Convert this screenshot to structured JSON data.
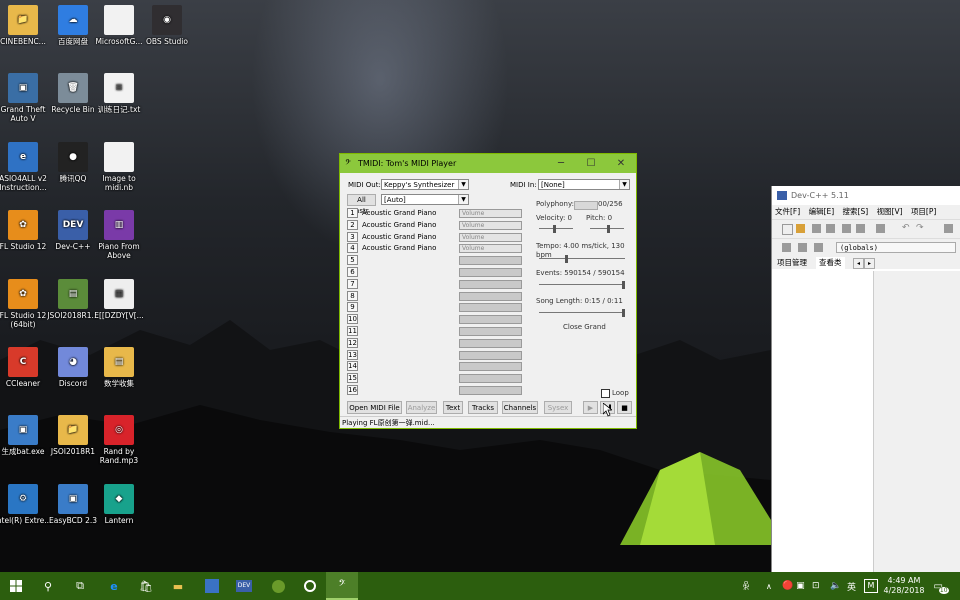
{
  "desktop": {
    "icons": [
      {
        "label": "CINEBENC...",
        "glyph": "📁",
        "color": "#e8b84a"
      },
      {
        "label": "百度网盘",
        "glyph": "☁",
        "color": "#2f7de1"
      },
      {
        "label": "MicrosoftG...",
        "glyph": "",
        "color": "#f2f2f2"
      },
      {
        "label": "OBS Studio",
        "glyph": "◉",
        "color": "#302e31"
      },
      {
        "label": "Grand Theft Auto V",
        "glyph": "▣",
        "color": "#3a6ea5"
      },
      {
        "label": "Recycle Bin",
        "glyph": "🗑",
        "color": "#7c8c99"
      },
      {
        "label": "训练日记.txt",
        "glyph": "≡",
        "color": "#f2f2f2"
      },
      {
        "label": "ASIO4ALL v2 Instruction...",
        "glyph": "e",
        "color": "#2f72c4"
      },
      {
        "label": "腾讯QQ",
        "glyph": "●",
        "color": "#222"
      },
      {
        "label": "Image to midi.nb",
        "glyph": "",
        "color": "#f2f2f2"
      },
      {
        "label": "FL Studio 12",
        "glyph": "✿",
        "color": "#e78d1b"
      },
      {
        "label": "Dev-C++",
        "glyph": "DEV",
        "color": "#3a5fa8"
      },
      {
        "label": "Piano From Above",
        "glyph": "▥",
        "color": "#7a3aa8"
      },
      {
        "label": "FL Studio 12 (64bit)",
        "glyph": "✿",
        "color": "#e78d1b"
      },
      {
        "label": "JSOI2018R1...",
        "glyph": "▤",
        "color": "#5b8c3a"
      },
      {
        "label": "E[[DZDY[V[...",
        "glyph": "▦",
        "color": "#eeeeee"
      },
      {
        "label": "CCleaner",
        "glyph": "C",
        "color": "#d83a2a"
      },
      {
        "label": "Discord",
        "glyph": "◕",
        "color": "#7289da"
      },
      {
        "label": "数学收集",
        "glyph": "▤",
        "color": "#e8b84a"
      },
      {
        "label": "生成bat.exe",
        "glyph": "▣",
        "color": "#3a7cc8"
      },
      {
        "label": "JSOI2018R1",
        "glyph": "📁",
        "color": "#e8b84a"
      },
      {
        "label": "Rand by Rand.mp3",
        "glyph": "◎",
        "color": "#d8232a"
      },
      {
        "label": "Intel(R) Extre...",
        "glyph": "⚙",
        "color": "#2a76c4"
      },
      {
        "label": "EasyBCD 2.3",
        "glyph": "▣",
        "color": "#3a7cc8"
      },
      {
        "label": "Lantern",
        "glyph": "◆",
        "color": "#18a28c"
      }
    ]
  },
  "tmidi": {
    "title": "TMIDI: Tom's MIDI Player",
    "minimize": "─",
    "maximize": "☐",
    "close": "✕",
    "midi_out_label": "MIDI Out:",
    "midi_out_value": "Keppy's Synthesizer",
    "midi_in_label": "MIDI In:",
    "midi_in_value": "[None]",
    "all_instr_label": "All Instr.",
    "instr_value": "[Auto]",
    "tracks": [
      {
        "num": "1",
        "name": "Acoustic Grand Piano",
        "vol": "Volume"
      },
      {
        "num": "2",
        "name": "Acoustic Grand Piano",
        "vol": "Volume"
      },
      {
        "num": "3",
        "name": "Acoustic Grand Piano",
        "vol": "Volume"
      },
      {
        "num": "4",
        "name": "Acoustic Grand Piano",
        "vol": "Volume"
      },
      {
        "num": "5",
        "name": "",
        "vol": ""
      },
      {
        "num": "6",
        "name": "",
        "vol": ""
      },
      {
        "num": "7",
        "name": "",
        "vol": ""
      },
      {
        "num": "8",
        "name": "",
        "vol": ""
      },
      {
        "num": "9",
        "name": "",
        "vol": ""
      },
      {
        "num": "10",
        "name": "",
        "vol": ""
      },
      {
        "num": "11",
        "name": "",
        "vol": ""
      },
      {
        "num": "12",
        "name": "",
        "vol": ""
      },
      {
        "num": "13",
        "name": "",
        "vol": ""
      },
      {
        "num": "14",
        "name": "",
        "vol": ""
      },
      {
        "num": "15",
        "name": "",
        "vol": ""
      },
      {
        "num": "16",
        "name": "",
        "vol": ""
      }
    ],
    "polyphony_label": "Polyphony:",
    "polyphony_value": "00/256",
    "velocity_label": "Velocity: 0",
    "pitch_label": "Pitch: 0",
    "tempo_label": "Tempo: 4.00 ms/tick, 130 bpm",
    "events_label": "Events: 590154 / 590154",
    "song_length_label": "Song Length: 0:15 / 0:11",
    "close_grand_label": "Close Grand",
    "loop_label": "Loop",
    "buttons": {
      "open": "Open MIDI File",
      "analyze": "Analyze",
      "text": "Text",
      "tracks": "Tracks",
      "channels": "Channels",
      "sysex": "Sysex"
    },
    "play_glyph": "▶",
    "pause_glyph": "❚❚",
    "stop_glyph": "■",
    "status": "Playing FL原创第一弹.mid..."
  },
  "devcpp": {
    "title": "Dev-C++ 5.11",
    "menu": [
      "文件[F]",
      "编辑[E]",
      "搜索[S]",
      "视图[V]",
      "项目[P]"
    ],
    "globals": "(globals)",
    "tab_project": "项目管理",
    "tab_class": "查看类"
  },
  "taskbar": {
    "time": "4:49 AM",
    "date": "4/28/2018",
    "ime": "英",
    "tray_m": "M",
    "notif_count": "10"
  }
}
